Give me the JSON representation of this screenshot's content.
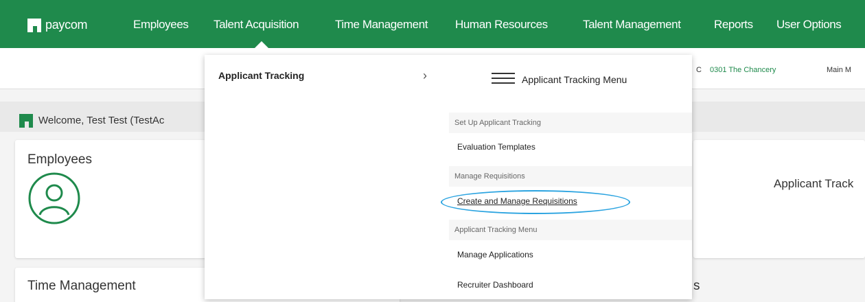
{
  "brand": {
    "name": "paycom",
    "mark": "·"
  },
  "nav": {
    "items": [
      {
        "label": "Employees"
      },
      {
        "label": "Talent Acquisition"
      },
      {
        "label": "Time Management"
      },
      {
        "label": "Human Resources"
      },
      {
        "label": "Talent Management"
      },
      {
        "label": "Reports"
      },
      {
        "label": "User Options"
      }
    ]
  },
  "subbar": {
    "cut_text": "C",
    "location": "0301 The Chancery",
    "main_menu_partial": "Main M"
  },
  "welcome": {
    "text": "Welcome, Test Test  (TestAc"
  },
  "cards": {
    "employees_title": "Employees",
    "applicant_title_partial": "Applicant Track",
    "time_title": "Time Management",
    "bottom_partial": "s"
  },
  "dropdown": {
    "category": "Applicant Tracking",
    "chevron": "›",
    "menu_title": "Applicant Tracking Menu",
    "sections": [
      {
        "header": "Set Up Applicant Tracking",
        "links": [
          "Evaluation Templates"
        ]
      },
      {
        "header": "Manage Requisitions",
        "links": [
          "Create and Manage Requisitions"
        ]
      },
      {
        "header": "Applicant Tracking Menu",
        "links": [
          "Manage Applications",
          "Recruiter Dashboard"
        ]
      }
    ]
  },
  "colors": {
    "brand_green": "#1f8a4c",
    "highlight": "#2aa3e0",
    "link_green": "#1f8a4c"
  }
}
